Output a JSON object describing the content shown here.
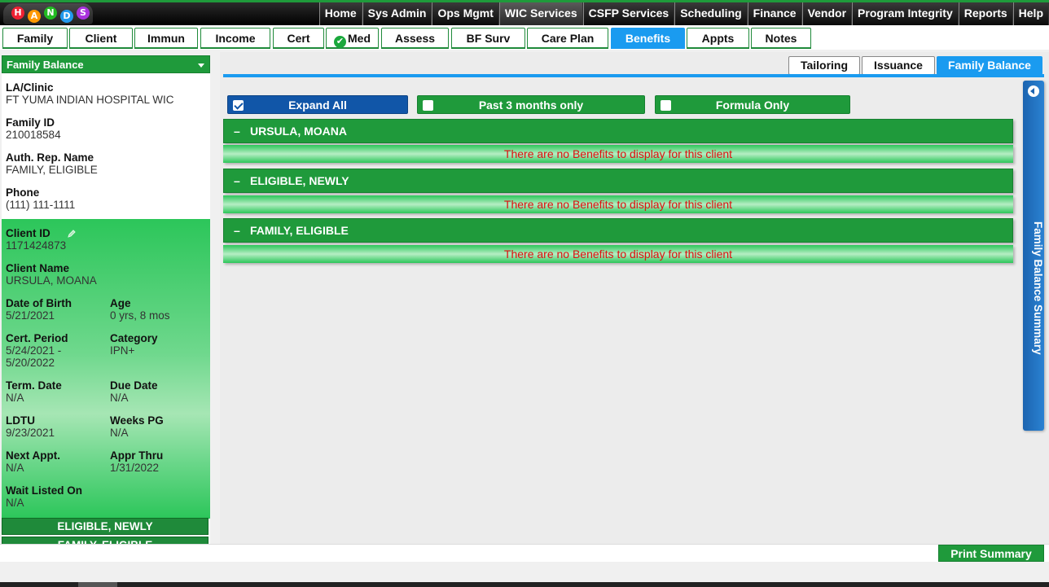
{
  "topnav": {
    "logo_letters": [
      "H",
      "A",
      "N",
      "D",
      "S"
    ],
    "items": [
      "Home",
      "Sys Admin",
      "Ops Mgmt",
      "WIC Services",
      "CSFP Services",
      "Scheduling",
      "Finance",
      "Vendor",
      "Program Integrity",
      "Reports",
      "Help"
    ],
    "active": "WIC Services"
  },
  "tabs": [
    "Family",
    "Client",
    "Immun",
    "Income",
    "Cert",
    "Med",
    "Assess",
    "BF Surv",
    "Care Plan",
    "Benefits",
    "Appts",
    "Notes"
  ],
  "active_tab": "Benefits",
  "left_panel": {
    "header": "Family Balance",
    "la_clinic_label": "LA/Clinic",
    "la_clinic_value": "FT YUMA INDIAN HOSPITAL WIC",
    "family_id_label": "Family ID",
    "family_id_value": "210018584",
    "auth_rep_label": "Auth. Rep. Name",
    "auth_rep_value": "FAMILY, ELIGIBLE",
    "phone_label": "Phone",
    "phone_value": "(111) 111-1111",
    "client_id_label": "Client ID",
    "client_id_value": "1171424873",
    "client_name_label": "Client Name",
    "client_name_value": "URSULA, MOANA",
    "dob_label": "Date of Birth",
    "dob_value": "5/21/2021",
    "age_label": "Age",
    "age_value": "0 yrs, 8 mos",
    "cert_period_label": "Cert. Period",
    "cert_period_value1": "5/24/2021 -",
    "cert_period_value2": "5/20/2022",
    "category_label": "Category",
    "category_value": "IPN+",
    "term_date_label": "Term. Date",
    "term_date_value": "N/A",
    "due_date_label": "Due Date",
    "due_date_value": "N/A",
    "ldtu_label": "LDTU",
    "ldtu_value": "9/23/2021",
    "weeks_pg_label": "Weeks PG",
    "weeks_pg_value": "N/A",
    "next_appt_label": "Next Appt.",
    "next_appt_value": "N/A",
    "appr_thru_label": "Appr Thru",
    "appr_thru_value": "1/31/2022",
    "wait_listed_label": "Wait Listed On",
    "wait_listed_value": "N/A",
    "other_clients": [
      "ELIGIBLE, NEWLY",
      "FAMILY, ELIGIBLE"
    ]
  },
  "subtabs": [
    "Tailoring",
    "Issuance",
    "Family Balance"
  ],
  "active_subtab": "Family Balance",
  "filters": {
    "expand_all": "Expand All",
    "past_3_months": "Past 3 months only",
    "formula_only": "Formula Only"
  },
  "sections": [
    {
      "name": "URSULA, MOANA",
      "message": "There are no Benefits to display for this client"
    },
    {
      "name": "ELIGIBLE, NEWLY",
      "message": "There are no Benefits to display for this client"
    },
    {
      "name": "FAMILY, ELIGIBLE",
      "message": "There are no Benefits to display for this client"
    }
  ],
  "collapse_symbol": "–",
  "side_panel_label": "Family Balance Summary",
  "print_button": "Print Summary",
  "colors": {
    "green": "#1f9a3b",
    "blue": "#1a9bf0",
    "error_red": "#e01010"
  }
}
